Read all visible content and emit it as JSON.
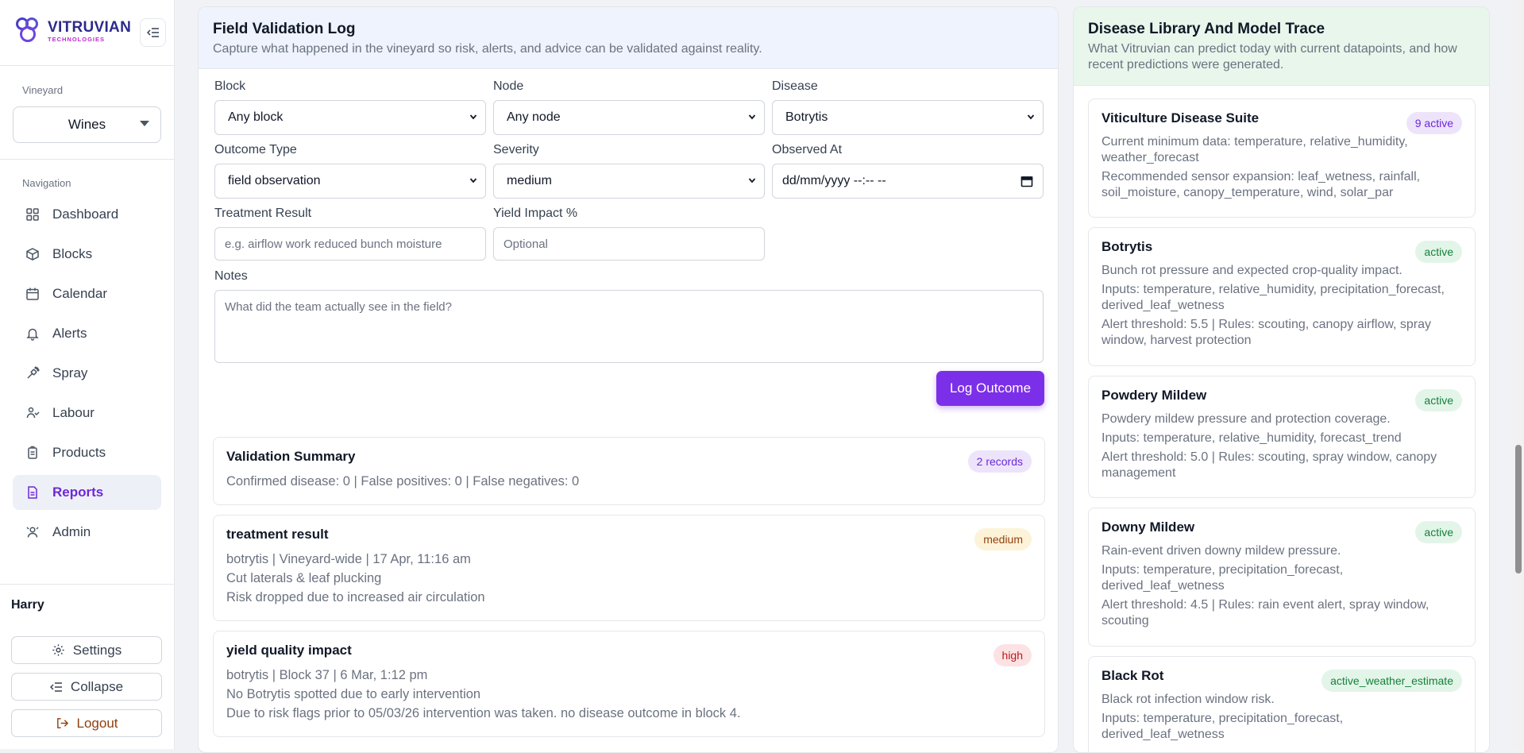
{
  "brand": {
    "name": "VITRUVIAN",
    "sub": "TECHNOLOGIES"
  },
  "sidebar": {
    "vineyard_label": "Vineyard",
    "vineyard_value": "Wines",
    "nav_label": "Navigation",
    "items": [
      {
        "label": "Dashboard",
        "icon": "dashboard-icon"
      },
      {
        "label": "Blocks",
        "icon": "blocks-icon"
      },
      {
        "label": "Calendar",
        "icon": "calendar-icon"
      },
      {
        "label": "Alerts",
        "icon": "bell-icon"
      },
      {
        "label": "Spray",
        "icon": "spray-icon"
      },
      {
        "label": "Labour",
        "icon": "labour-icon"
      },
      {
        "label": "Products",
        "icon": "products-icon"
      },
      {
        "label": "Reports",
        "icon": "report-icon",
        "active": true
      },
      {
        "label": "Admin",
        "icon": "admin-icon"
      }
    ],
    "user": "Harry",
    "settings_label": "Settings",
    "collapse_label": "Collapse",
    "logout_label": "Logout"
  },
  "validation": {
    "title": "Field Validation Log",
    "subtitle": "Capture what happened in the vineyard so risk, alerts, and advice can be validated against reality.",
    "form": {
      "block_label": "Block",
      "block_value": "Any block",
      "node_label": "Node",
      "node_value": "Any node",
      "disease_label": "Disease",
      "disease_value": "Botrytis",
      "outcome_label": "Outcome Type",
      "outcome_value": "field observation",
      "severity_label": "Severity",
      "severity_value": "medium",
      "observed_label": "Observed At",
      "observed_value": "dd/mm/yyyy --:-- --",
      "treatment_label": "Treatment Result",
      "treatment_placeholder": "e.g. airflow work reduced bunch moisture",
      "yield_label": "Yield Impact %",
      "yield_placeholder": "Optional",
      "notes_label": "Notes",
      "notes_placeholder": "What did the team actually see in the field?",
      "submit_label": "Log Outcome"
    },
    "summary": {
      "title": "Validation Summary",
      "badge": "2 records",
      "line": "Confirmed disease: 0 | False positives: 0 | False negatives: 0"
    },
    "records": [
      {
        "title": "treatment result",
        "badge": "medium",
        "meta": "botrytis | Vineyard-wide | 17 Apr, 11:16 am",
        "line1": "Cut laterals & leaf plucking",
        "line2": "Risk dropped due to increased air circulation"
      },
      {
        "title": "yield quality impact",
        "badge": "high",
        "meta": "botrytis | Block 37 | 6 Mar, 1:12 pm",
        "line1": "No Botrytis spotted due to early intervention",
        "line2": "Due to risk flags prior to 05/03/26 intervention was taken. no disease outcome in block 4."
      }
    ]
  },
  "library": {
    "title": "Disease Library And Model Trace",
    "subtitle": "What Vitruvian can predict today with current datapoints, and how recent predictions were generated.",
    "cards": [
      {
        "title": "Viticulture Disease Suite",
        "badge": "9 active",
        "badge_color": "purple",
        "lines": [
          "Current minimum data: temperature, relative_humidity, weather_forecast",
          "Recommended sensor expansion: leaf_wetness, rainfall, soil_moisture, canopy_temperature, wind, solar_par"
        ]
      },
      {
        "title": "Botrytis",
        "badge": "active",
        "badge_color": "green",
        "lines": [
          "Bunch rot pressure and expected crop-quality impact.",
          "Inputs: temperature, relative_humidity, precipitation_forecast, derived_leaf_wetness",
          "Alert threshold: 5.5 | Rules: scouting, canopy airflow, spray window, harvest protection"
        ]
      },
      {
        "title": "Powdery Mildew",
        "badge": "active",
        "badge_color": "green",
        "lines": [
          "Powdery mildew pressure and protection coverage.",
          "Inputs: temperature, relative_humidity, forecast_trend",
          "Alert threshold: 5.0 | Rules: scouting, spray window, canopy management"
        ]
      },
      {
        "title": "Downy Mildew",
        "badge": "active",
        "badge_color": "green",
        "lines": [
          "Rain-event driven downy mildew pressure.",
          "Inputs: temperature, precipitation_forecast, derived_leaf_wetness",
          "Alert threshold: 4.5 | Rules: rain event alert, spray window, scouting"
        ]
      },
      {
        "title": "Black Rot",
        "badge": "active_weather_estimate",
        "badge_color": "green",
        "lines": [
          "Black rot infection window risk.",
          "Inputs: temperature, precipitation_forecast, derived_leaf_wetness"
        ]
      }
    ]
  }
}
